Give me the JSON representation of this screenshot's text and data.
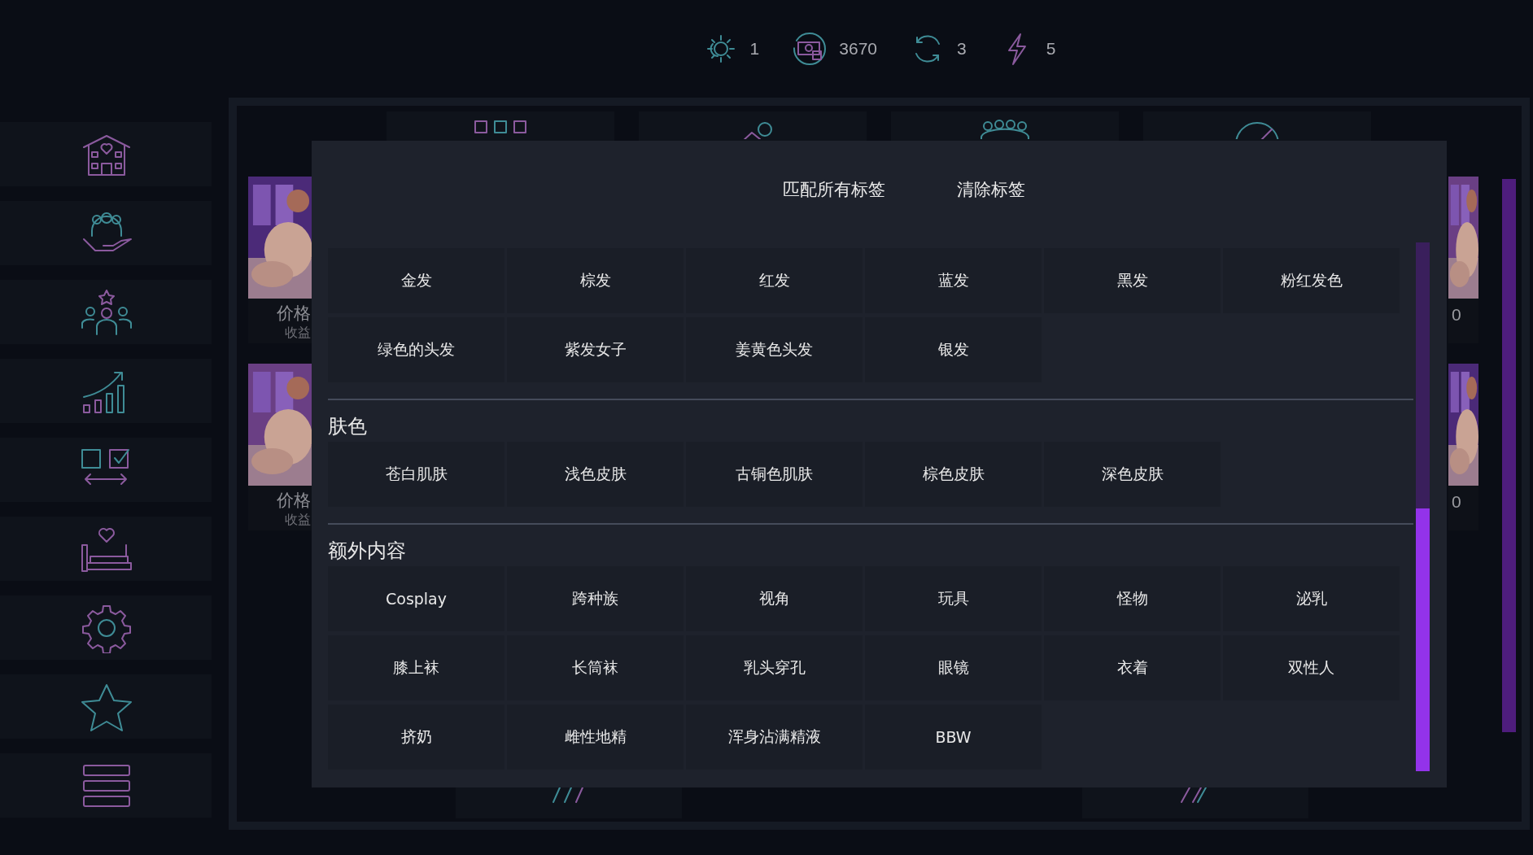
{
  "stats": [
    {
      "value": "1"
    },
    {
      "value": "3670"
    },
    {
      "value": "3"
    },
    {
      "value": "5"
    }
  ],
  "cards_left": [
    {
      "price_label": "价格",
      "income_label": "收益"
    },
    {
      "price_label": "价格",
      "income_label": "收益"
    }
  ],
  "cards_right": [
    {
      "value": "0"
    },
    {
      "value": "0"
    }
  ],
  "tag_dialog": {
    "actions": [
      "匹配所有标签",
      "清除标签"
    ],
    "sections": [
      {
        "tags": [
          {
            "label": "金发",
            "selected": false
          },
          {
            "label": "棕发",
            "selected": false
          },
          {
            "label": "红发",
            "selected": false
          },
          {
            "label": "蓝发",
            "selected": false
          },
          {
            "label": "黑发",
            "selected": false
          },
          {
            "label": "粉红发色",
            "selected": false
          },
          {
            "label": "绿色的头发",
            "selected": false
          },
          {
            "label": "紫发女子",
            "selected": false
          },
          {
            "label": "姜黄色头发",
            "selected": false
          },
          {
            "label": "银发",
            "selected": false
          }
        ]
      },
      {
        "heading": "肤色",
        "tags": [
          {
            "label": "苍白肌肤",
            "selected": false
          },
          {
            "label": "浅色皮肤",
            "selected": false
          },
          {
            "label": "古铜色肌肤",
            "selected": false
          },
          {
            "label": "棕色皮肤",
            "selected": false
          },
          {
            "label": "深色皮肤",
            "selected": false
          }
        ]
      },
      {
        "heading": "额外内容",
        "tags": [
          {
            "label": "Cosplay",
            "selected": false
          },
          {
            "label": "跨种族",
            "selected": false
          },
          {
            "label": "视角",
            "selected": false
          },
          {
            "label": "玩具",
            "selected": false
          },
          {
            "label": "怪物",
            "selected": false
          },
          {
            "label": "泌乳",
            "selected": false
          },
          {
            "label": "膝上袜",
            "selected": false
          },
          {
            "label": "长筒袜",
            "selected": false
          },
          {
            "label": "乳头穿孔",
            "selected": false
          },
          {
            "label": "眼镜",
            "selected": false
          },
          {
            "label": "衣着",
            "selected": false
          },
          {
            "label": "双性人",
            "selected": false
          },
          {
            "label": "挤奶",
            "selected": false
          },
          {
            "label": "雌性地精",
            "selected": false
          },
          {
            "label": "浑身沾满精液",
            "selected": false
          },
          {
            "label": "BBW",
            "selected": false
          }
        ]
      }
    ]
  }
}
